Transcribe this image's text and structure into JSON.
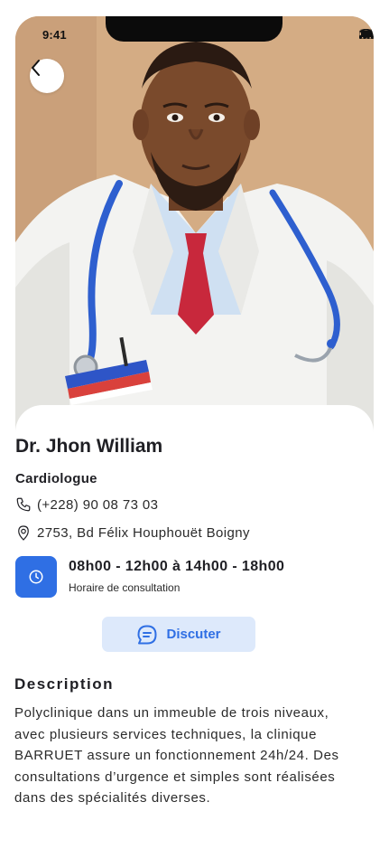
{
  "status_bar": {
    "time": "9:41"
  },
  "header": {
    "back_icon": "chevron-left-icon"
  },
  "doctor": {
    "name": "Dr. Jhon William",
    "specialty": "Cardiologue",
    "phone": "(+228) 90 08 73 03",
    "address": "2753, Bd Félix Houphouët Boigny",
    "hours": "08h00 - 12h00 à 14h00 - 18h00",
    "hours_label": "Horaire de consultation"
  },
  "actions": {
    "chat_label": "Discuter",
    "chat_icon": "chat-bubble-icon"
  },
  "description": {
    "title": "Description",
    "text": "Polyclinique dans un immeuble de trois niveaux, avec plusieurs services techniques, la clinique BARRUET assure un fonctionnement 24h/24. Des consultations d’urgence et simples sont réalisées dans des spécialités diverses."
  },
  "colors": {
    "accent": "#2f6fe4",
    "accent_light": "#dde9fb",
    "text": "#1f1f24"
  }
}
